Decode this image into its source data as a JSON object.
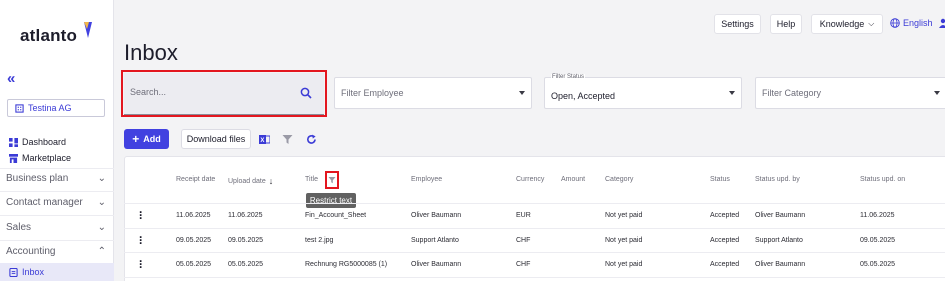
{
  "app": {
    "logo_text": "atlanto",
    "brand_color": "#4141e0"
  },
  "sidebar": {
    "collapse_icon": "double-chevron-left-icon",
    "company": "Testina AG",
    "items": [
      {
        "label": "Dashboard",
        "icon": "grid-icon"
      },
      {
        "label": "Marketplace",
        "icon": "store-icon"
      }
    ],
    "sections": [
      {
        "label": "Business plan",
        "expanded": false
      },
      {
        "label": "Contact manager",
        "expanded": false
      },
      {
        "label": "Sales",
        "expanded": false
      },
      {
        "label": "Accounting",
        "expanded": true
      }
    ],
    "active_item": {
      "label": "Inbox",
      "icon": "inbox-doc-icon"
    }
  },
  "topbar": {
    "settings": "Settings",
    "help": "Help",
    "knowledge": "Knowledge",
    "language": "English"
  },
  "page": {
    "title": "Inbox"
  },
  "filters": {
    "search_placeholder": "Search...",
    "employee_placeholder": "Filter Employee",
    "status_label": "Filter Status",
    "status_value": "Open, Accepted",
    "category_placeholder": "Filter Category"
  },
  "actions": {
    "add": "Add",
    "download": "Download files"
  },
  "table": {
    "headers": [
      "Receipt date",
      "Upload date",
      "Title",
      "Employee",
      "Currency",
      "Amount",
      "Category",
      "Status",
      "Status upd. by",
      "Status upd. on"
    ],
    "tooltip": "Restrict text",
    "rows": [
      [
        "11.06.2025",
        "11.06.2025",
        "Fin_Account_Sheet",
        "Oliver Baumann",
        "EUR",
        "",
        "Not yet paid",
        "Accepted",
        "Oliver Baumann",
        "11.06.2025"
      ],
      [
        "09.05.2025",
        "09.05.2025",
        "test 2.jpg",
        "Support Atlanto",
        "CHF",
        "",
        "Not yet paid",
        "Accepted",
        "Support Atlanto",
        "09.05.2025"
      ],
      [
        "05.05.2025",
        "05.05.2025",
        "Rechnung RG5000085 (1)",
        "Oliver Baumann",
        "CHF",
        "",
        "Not yet paid",
        "Accepted",
        "Oliver Baumann",
        "05.05.2025"
      ]
    ]
  }
}
